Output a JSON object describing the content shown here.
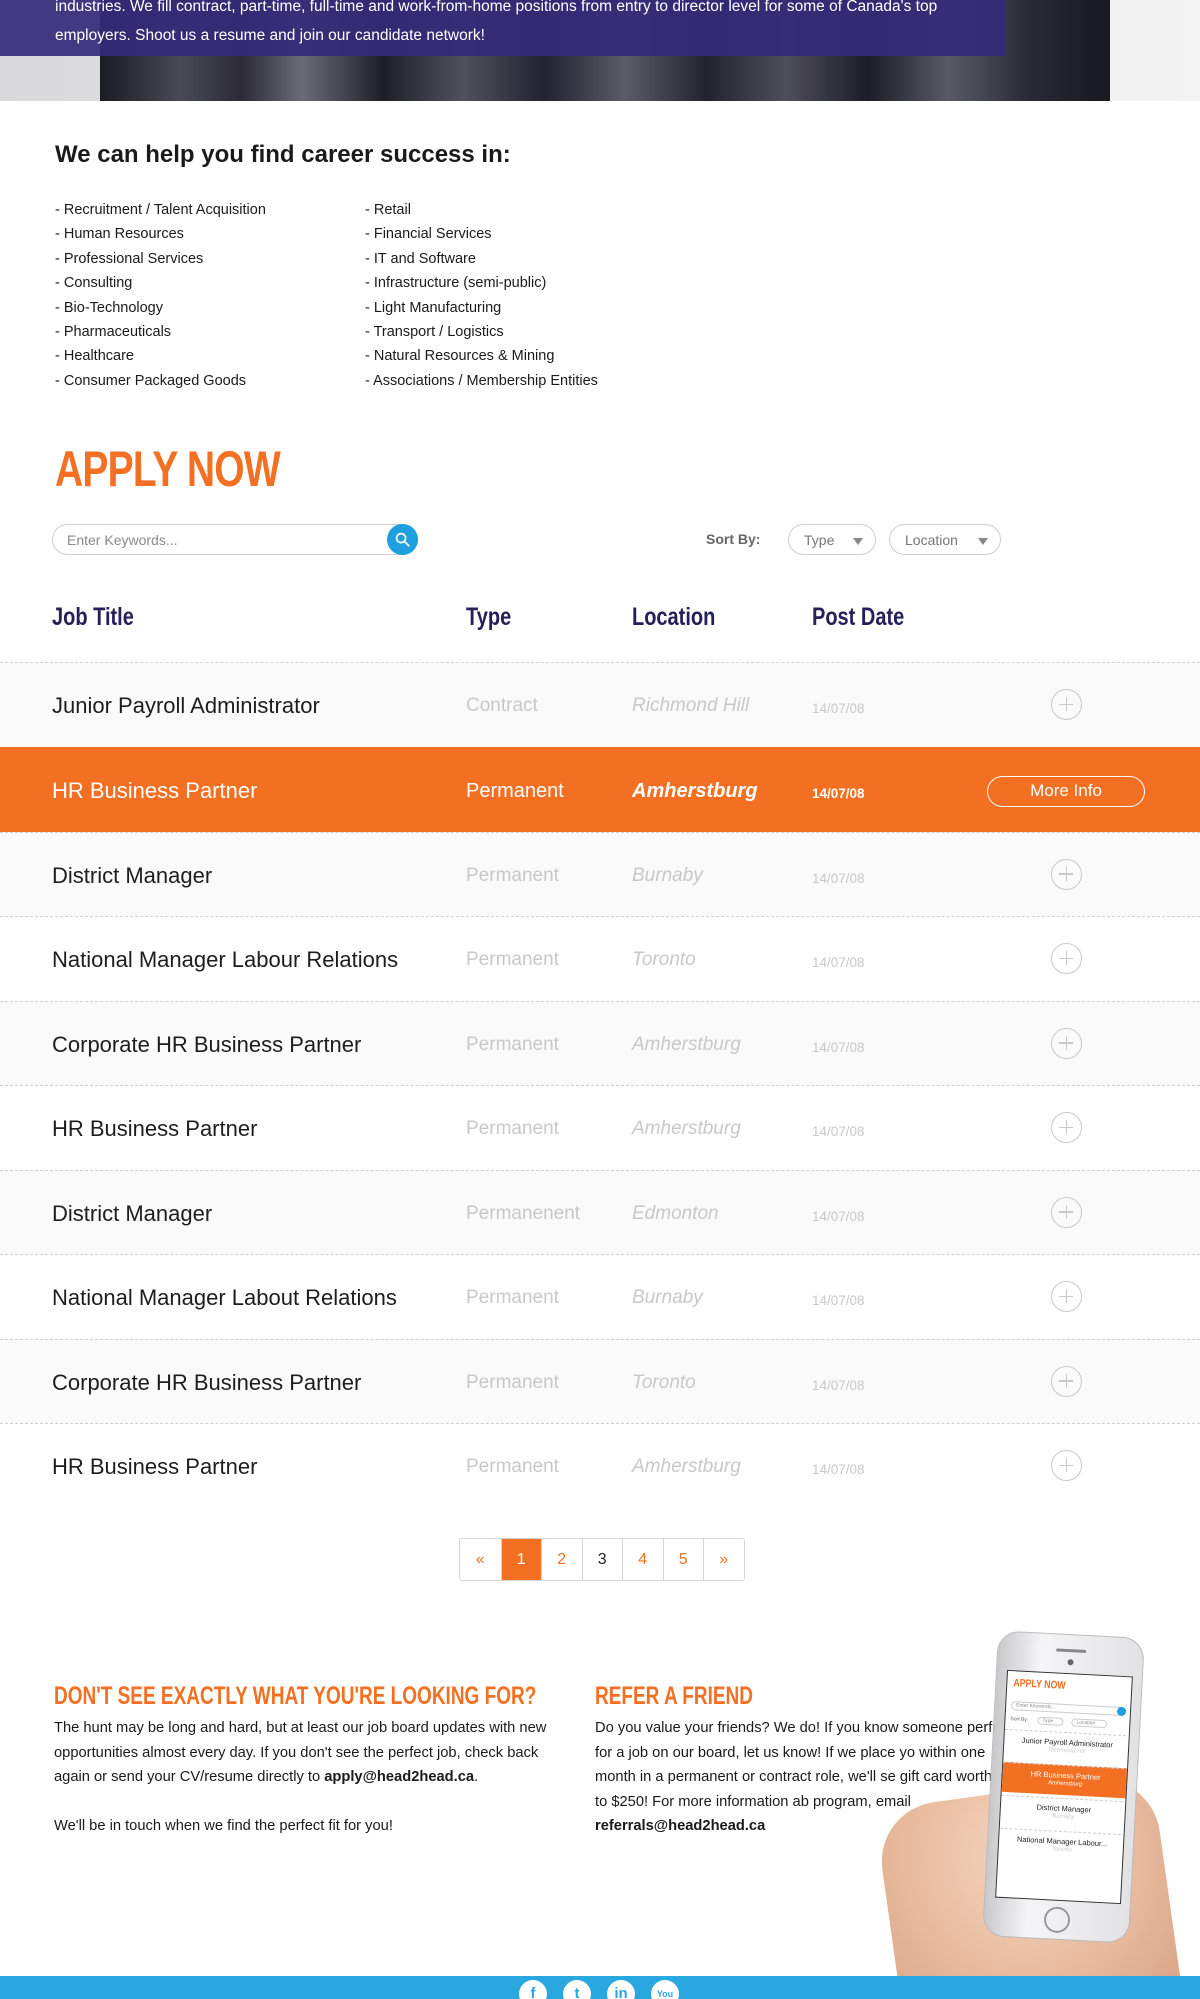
{
  "hero": {
    "text": "industries. We fill contract, part-time, full-time and work-from-home positions from entry to director level for some of Canada's top employers. Shoot us a resume and join our candidate network!"
  },
  "industries": {
    "title": "We can help you find career success in:",
    "col1": [
      "- Recruitment / Talent Acquisition",
      "- Human Resources",
      "- Professional Services",
      "- Consulting",
      "- Bio-Technology",
      "- Pharmaceuticals",
      "- Healthcare",
      "- Consumer Packaged Goods"
    ],
    "col2": [
      "- Retail",
      "- Financial Services",
      "- IT and Software",
      "- Infrastructure (semi-public)",
      "- Light Manufacturing",
      "- Transport / Logistics",
      "- Natural Resources & Mining",
      "- Associations / Membership Entities"
    ]
  },
  "apply": {
    "title": "APPLY NOW",
    "search_placeholder": "Enter Keywords...",
    "sort_label": "Sort By:",
    "sort_type": "Type",
    "sort_location": "Location"
  },
  "table": {
    "headers": [
      "Job Title",
      "Type",
      "Location",
      "Post Date"
    ],
    "more_info": "More Info",
    "rows": [
      {
        "title": "Junior Payroll Administrator",
        "type": "Contract",
        "location": "Richmond Hill",
        "date": "14/07/08"
      },
      {
        "title": "HR Business Partner",
        "type": "Permanent",
        "location": "Amherstburg",
        "date": "14/07/08",
        "active": true
      },
      {
        "title": "District Manager",
        "type": "Permanent",
        "location": "Burnaby",
        "date": "14/07/08"
      },
      {
        "title": "National Manager Labour Relations",
        "type": "Permanent",
        "location": "Toronto",
        "date": "14/07/08"
      },
      {
        "title": "Corporate HR Business Partner",
        "type": "Permanent",
        "location": "Amherstburg",
        "date": "14/07/08"
      },
      {
        "title": "HR Business Partner",
        "type": "Permanent",
        "location": "Amherstburg",
        "date": "14/07/08"
      },
      {
        "title": "District Manager",
        "type": "Permanenent",
        "location": "Edmonton",
        "date": "14/07/08"
      },
      {
        "title": "National Manager Labout Relations",
        "type": "Permanent",
        "location": "Burnaby",
        "date": "14/07/08"
      },
      {
        "title": "Corporate HR Business Partner",
        "type": "Permanent",
        "location": "Toronto",
        "date": "14/07/08"
      },
      {
        "title": "HR Business Partner",
        "type": "Permanent",
        "location": "Amherstburg",
        "date": "14/07/08"
      }
    ]
  },
  "pagination": {
    "prev": "«",
    "pages": [
      "1",
      "2",
      "3",
      "4",
      "5"
    ],
    "current": "1",
    "next": "»"
  },
  "dont_see": {
    "title": "DON'T SEE EXACTLY WHAT YOU'RE LOOKING FOR?",
    "text1": "The hunt may be long and hard, but at least our job board updates with new opportunities almost every day. If you don't see the perfect job, check back again or send your CV/resume directly to",
    "email": "apply@head2head.ca",
    "text2": "We'll be in touch when we find the perfect fit for you!"
  },
  "refer": {
    "title": "REFER A FRIEND",
    "text": "Do you value your friends? We do! If you know someone perfect for a job on our board, let us know! If we place yo within one month in a permanent or contract role, we'll se gift card worth up to $250! For more information ab program, email",
    "email": "referrals@head2head.ca"
  },
  "phone": {
    "title": "APPLY NOW",
    "search": "Enter Keywords...",
    "sort": "Sort By:",
    "type": "Type",
    "location": "Location",
    "rows": [
      {
        "title": "Junior Payroll Administrator",
        "sub": "Richmond Hill"
      },
      {
        "title": "HR Business Partner",
        "sub": "Amherstburg",
        "active": true
      },
      {
        "title": "District Manager",
        "sub": "Burnaby"
      },
      {
        "title": "National Manager Labour...",
        "sub": "Toronto"
      }
    ]
  },
  "footer": {
    "social": [
      "f",
      "t",
      "in",
      "You"
    ]
  },
  "colors": {
    "accent": "#f36f21",
    "navy": "#23205a",
    "footer": "#29a8e0",
    "search_button": "#1e9fe0"
  }
}
